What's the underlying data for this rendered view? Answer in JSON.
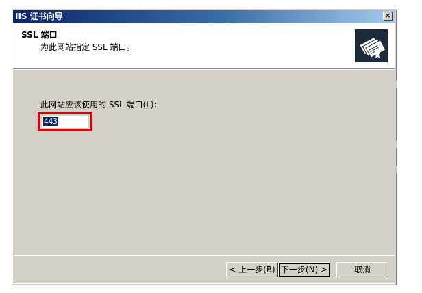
{
  "window": {
    "title": "IIS 证书向导",
    "close_glyph": "×"
  },
  "header": {
    "title": "SSL 端口",
    "subtitle": "为此网站指定 SSL 端口。",
    "icon": "certificate-wizard-icon"
  },
  "form": {
    "prompt": "此网站应该使用的 SSL 端口(L):",
    "port_value": "443"
  },
  "buttons": {
    "back": "< 上一步(B)",
    "next": "下一步(N) >",
    "cancel": "取消"
  },
  "colors": {
    "highlight": "#e00000",
    "title_bar": "#0a246a",
    "dialog_bg": "#d4d0c8"
  }
}
